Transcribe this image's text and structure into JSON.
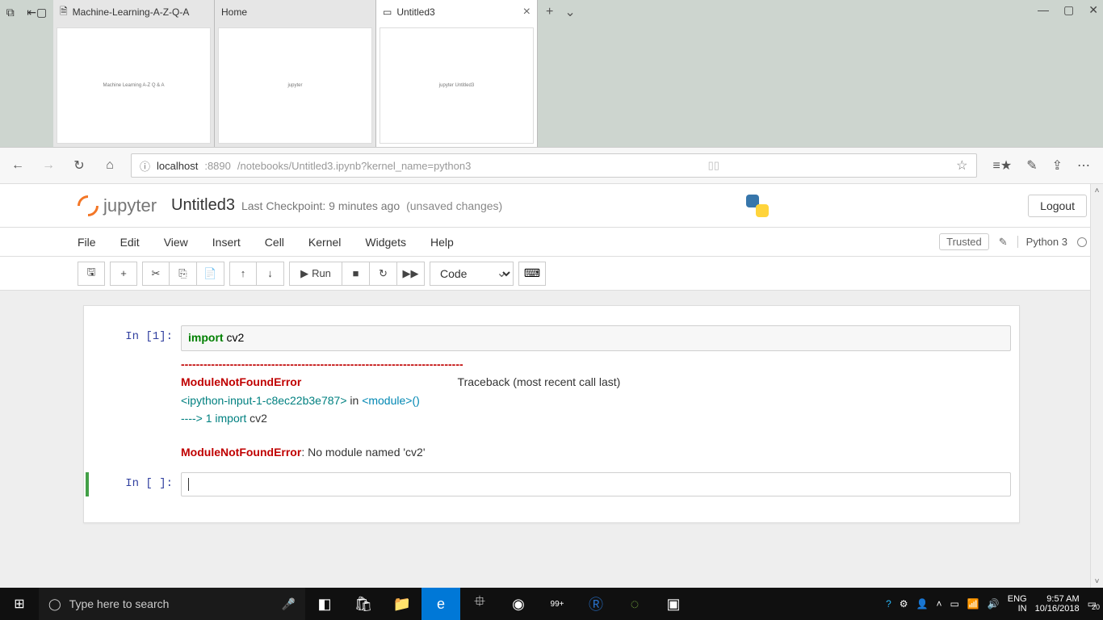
{
  "browser": {
    "tabs": [
      {
        "title": "Machine-Learning-A-Z-Q-A",
        "thumb_text": "Machine Learning A-Z\nQ & A"
      },
      {
        "title": "Home",
        "thumb_text": "jupyter"
      },
      {
        "title": "Untitled3",
        "thumb_text": "jupyter Untitled3"
      }
    ],
    "address": {
      "host": "localhost",
      "port": ":8890",
      "path": "/notebooks/Untitled3.ipynb?kernel_name=python3"
    },
    "window_controls": {
      "min": "—",
      "max": "▢",
      "close": "✕"
    }
  },
  "jupyter": {
    "brand": "jupyter",
    "notebook_title": "Untitled3",
    "checkpoint": "Last Checkpoint: 9 minutes ago",
    "unsaved": "(unsaved changes)",
    "logout": "Logout",
    "menus": [
      "File",
      "Edit",
      "View",
      "Insert",
      "Cell",
      "Kernel",
      "Widgets",
      "Help"
    ],
    "trusted": "Trusted",
    "kernel": "Python 3",
    "toolbar": {
      "run": "Run",
      "celltype": "Code"
    },
    "cells": [
      {
        "prompt": "In [1]:",
        "code_kw": "import",
        "code_rest": " cv2",
        "dashes": "---------------------------------------------------------------------------",
        "err_name": "ModuleNotFoundError",
        "traceback_label": "Traceback (most recent call last)",
        "frame_ref": "<ipython-input-1-c8ec22b3e787>",
        "in_word": " in ",
        "module_call": "<module>",
        "parens": "()",
        "arrow": "----> 1 ",
        "arrow_kw": "import",
        "arrow_rest": " cv2",
        "final_err": "ModuleNotFoundError",
        "final_msg": ": No module named 'cv2'"
      },
      {
        "prompt": "In [ ]:",
        "code": ""
      }
    ]
  },
  "taskbar": {
    "search_placeholder": "Type here to search",
    "lang1": "ENG",
    "lang2": "IN",
    "time": "9:57 AM",
    "date": "10/16/2018",
    "badge": "99+",
    "notif": "20"
  }
}
